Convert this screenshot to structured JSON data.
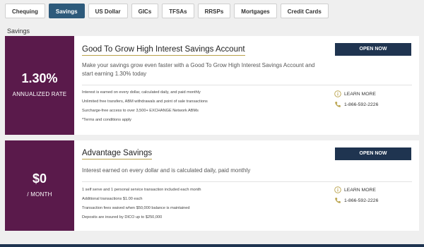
{
  "tabs": [
    {
      "label": "Chequing"
    },
    {
      "label": "Savings"
    },
    {
      "label": "US Dollar"
    },
    {
      "label": "GICs"
    },
    {
      "label": "TFSAs"
    },
    {
      "label": "RRSPs"
    },
    {
      "label": "Mortgages"
    },
    {
      "label": "Credit Cards"
    }
  ],
  "section_label": "Savings",
  "cards": [
    {
      "rate": "1.30%",
      "rate_label": "ANNUALIZED RATE",
      "title": "Good To Grow High Interest Savings Account",
      "description": "Make your savings grow even faster with a Good To Grow High Interest Savings Account and start earning 1.30% today",
      "features": [
        "Interest is earned on every dollar, calculated daily, and paid monthly",
        "Unlimited free transfers, ABM withdrawals and point of sale transactions",
        "Surcharge-free access to over 3,500+ EXCHANGE Network ABMs",
        "*Terms and conditions apply"
      ],
      "button": "OPEN NOW",
      "learn_more": "LEARN MORE",
      "phone": "1-866-592-2226"
    },
    {
      "rate": "$0",
      "rate_label": "/ MONTH",
      "title": "Advantage Savings",
      "description": "Interest earned on every dollar and is calculated daily, paid monthly",
      "features": [
        "1 self serve and 1 personal service transaction included each month",
        "Additional transactions $1.00 each",
        "Transaction fees waived when $50,000 balance is maintained",
        "Deposits are insured by DICO up to $250,000"
      ],
      "button": "OPEN NOW",
      "learn_more": "LEARN MORE",
      "phone": "1-866-592-2226"
    }
  ],
  "colors": {
    "accent": "#5a1a4b",
    "button": "#1f3450",
    "active_tab": "#2d5a7b",
    "title_underline": "#b9a24a"
  }
}
